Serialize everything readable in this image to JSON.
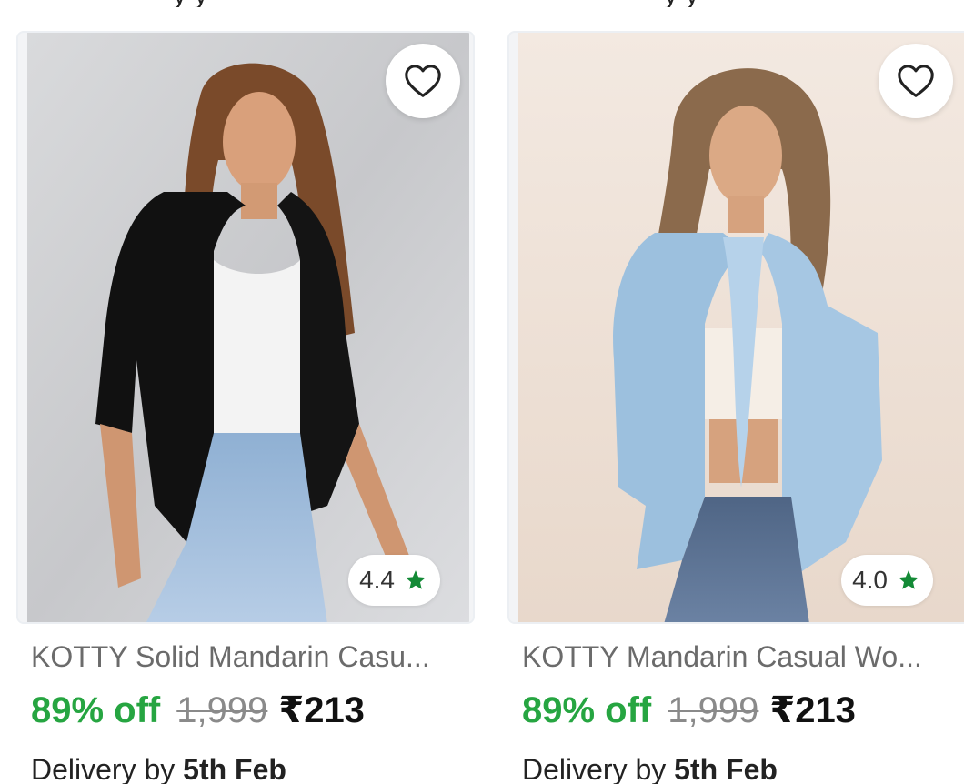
{
  "colors": {
    "discount_green": "#26a541",
    "rating_star_green": "#138a36",
    "mrp_gray": "#8a8a8a",
    "title_gray": "#6b6b6b",
    "text_dark": "#111111"
  },
  "products": [
    {
      "title": "KOTTY Solid Mandarin Casu...",
      "rating": "4.4",
      "discount": "89% off",
      "mrp": "1,999",
      "price": "₹213",
      "delivery_prefix": "Delivery by",
      "delivery_date": "5th Feb",
      "wishlist_icon": "heart-outline-icon",
      "rating_icon": "star-icon"
    },
    {
      "title": "KOTTY Mandarin Casual Wo...",
      "rating": "4.0",
      "discount": "89% off",
      "mrp": "1,999",
      "price": "₹213",
      "delivery_prefix": "Delivery by",
      "delivery_date": "5th Feb",
      "wishlist_icon": "heart-outline-icon",
      "rating_icon": "star-icon"
    }
  ]
}
